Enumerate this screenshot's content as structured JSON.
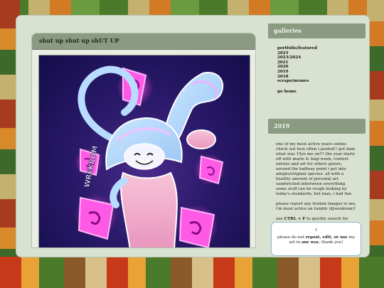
{
  "post": {
    "title": "shut up shut up shUT UP",
    "signature": "WREKROM"
  },
  "sidebar": {
    "galleries_heading": "galleries",
    "gallery_links": [
      "portfolio/featured",
      "2025",
      "2023/2024",
      "2021",
      "2020",
      "2019",
      "2018",
      "scraps/memes"
    ],
    "go_home": "go home",
    "year_heading": "2019",
    "about_paragraphs": [
      "one of my most active years online- check out how often i posted!! got dam what was 15yo me on!!! the year starts off with mario & luigi week, contest entries and art for others galore, around the halfway point i get into adopts/original species. all with a healthy amount of personal art sandwiched inbetween everything. some stuff can be rough looking by today's standards, but man, i had fun.",
      "please report any broken images to me, i'm most active on tumblr (@wrekrom)!"
    ],
    "search_tip": {
      "prefix": "use ",
      "keys": "CTRL + F",
      "suffix": " to quickly search for tags."
    },
    "notice": {
      "mark": "!",
      "before": "please do not ",
      "bold1": "repost, edit, or use",
      "middle": " my art in ",
      "bold2": "any way",
      "after": ", thank you!"
    }
  },
  "colors": {
    "frame": "#d9e1d0",
    "header": "#8b9b82",
    "art_bg": "#1d1060",
    "character_blue": "#a6d4ff",
    "character_pink": "#f0a8c8",
    "flame_magenta": "#ff44dd"
  }
}
